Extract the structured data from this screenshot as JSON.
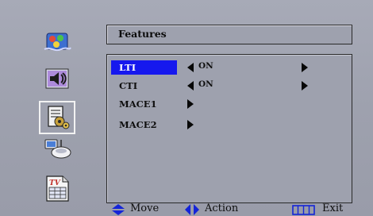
{
  "menu": {
    "title": "Features",
    "items": [
      {
        "label": "LTI",
        "value": "ON",
        "selected": true
      },
      {
        "label": "CTI",
        "value": "ON",
        "selected": false
      },
      {
        "label": "MACE1",
        "value": "",
        "selected": false
      },
      {
        "label": "MACE2",
        "value": "",
        "selected": false
      }
    ]
  },
  "sidebar": {
    "icons": [
      {
        "name": "picture-icon"
      },
      {
        "name": "sound-icon"
      },
      {
        "name": "features-icon",
        "selected": true
      },
      {
        "name": "setup-icon"
      },
      {
        "name": "tv-guide-icon"
      }
    ]
  },
  "help": {
    "move": "Move",
    "action": "Action",
    "exit": "Exit"
  },
  "colors": {
    "background": "#9ea1ae",
    "highlight": "#1618ee",
    "help_icon_blue": "#1424d8"
  }
}
